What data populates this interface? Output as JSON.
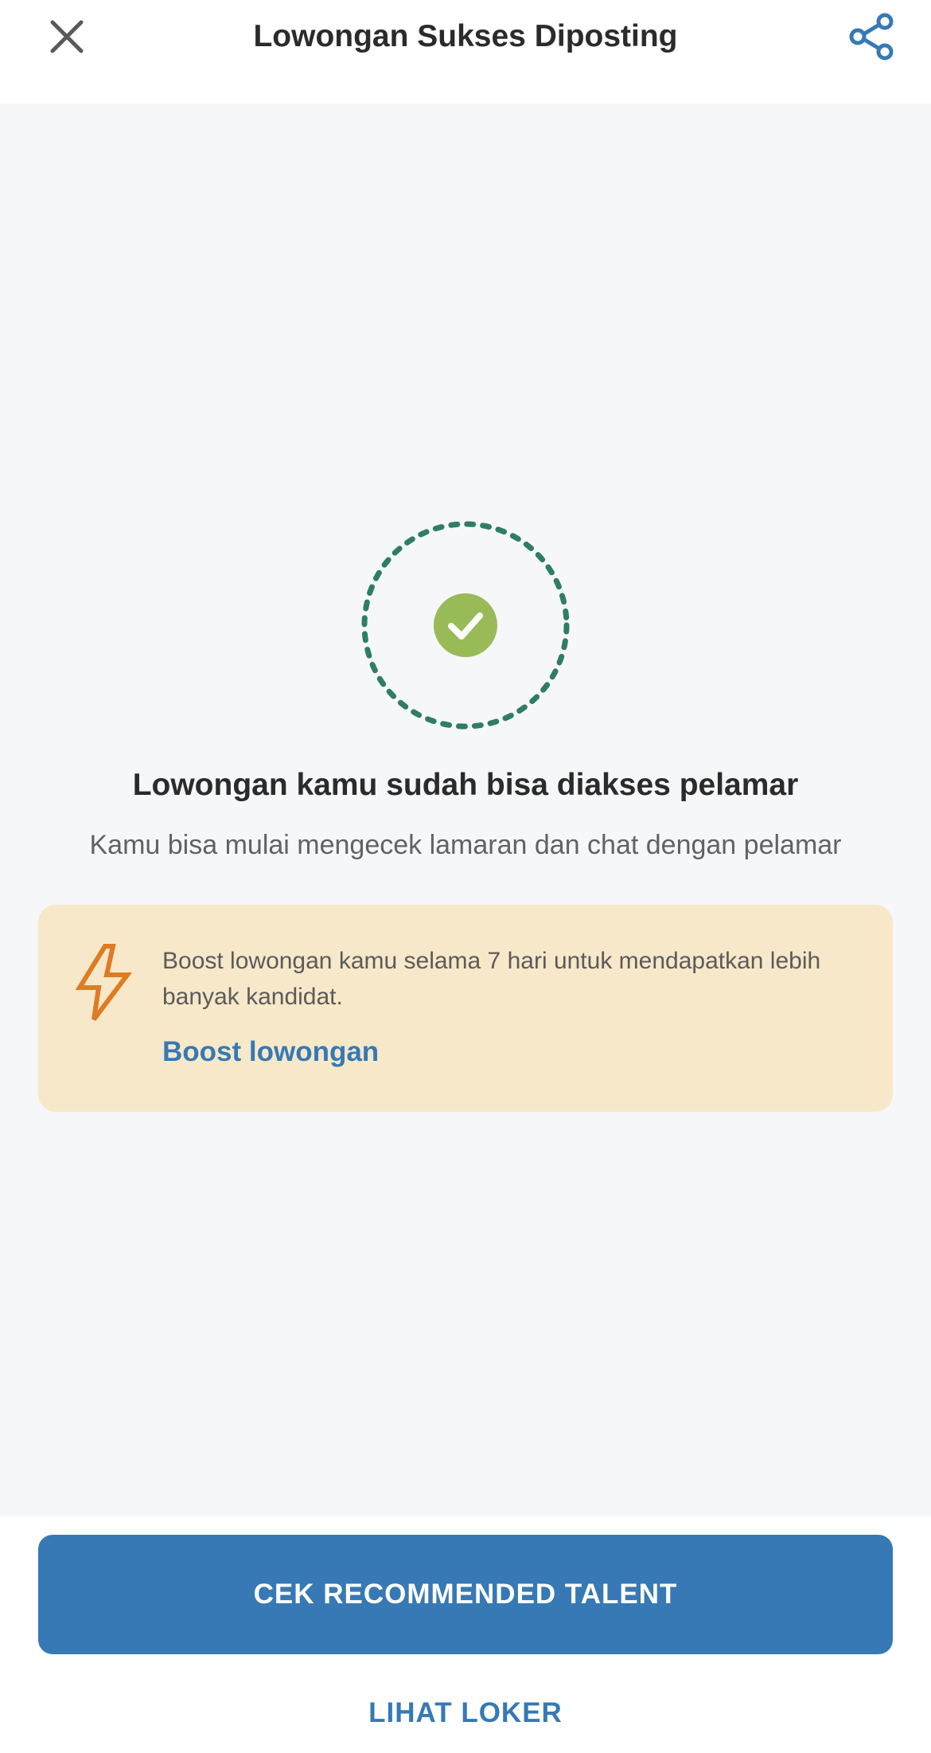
{
  "header": {
    "title": "Lowongan Sukses Diposting",
    "close_icon": "close-icon",
    "share_icon": "share-icon"
  },
  "success": {
    "icon": "check-icon",
    "headline": "Lowongan kamu sudah bisa diakses pelamar",
    "subline": "Kamu bisa mulai mengecek lamaran dan chat dengan pelamar"
  },
  "boost_card": {
    "icon": "lightning-icon",
    "text": "Boost lowongan kamu selama 7 hari untuk mendapatkan lebih banyak kandidat.",
    "link_label": "Boost lowongan"
  },
  "footer": {
    "primary_label": "CEK RECOMMENDED TALENT",
    "secondary_label": "LIHAT LOKER"
  },
  "colors": {
    "primary": "#3679b5",
    "success_green": "#99bb57",
    "dashed_ring": "#2f7d66",
    "boost_bg": "#f7e8c9",
    "boost_icon": "#e07b23"
  }
}
